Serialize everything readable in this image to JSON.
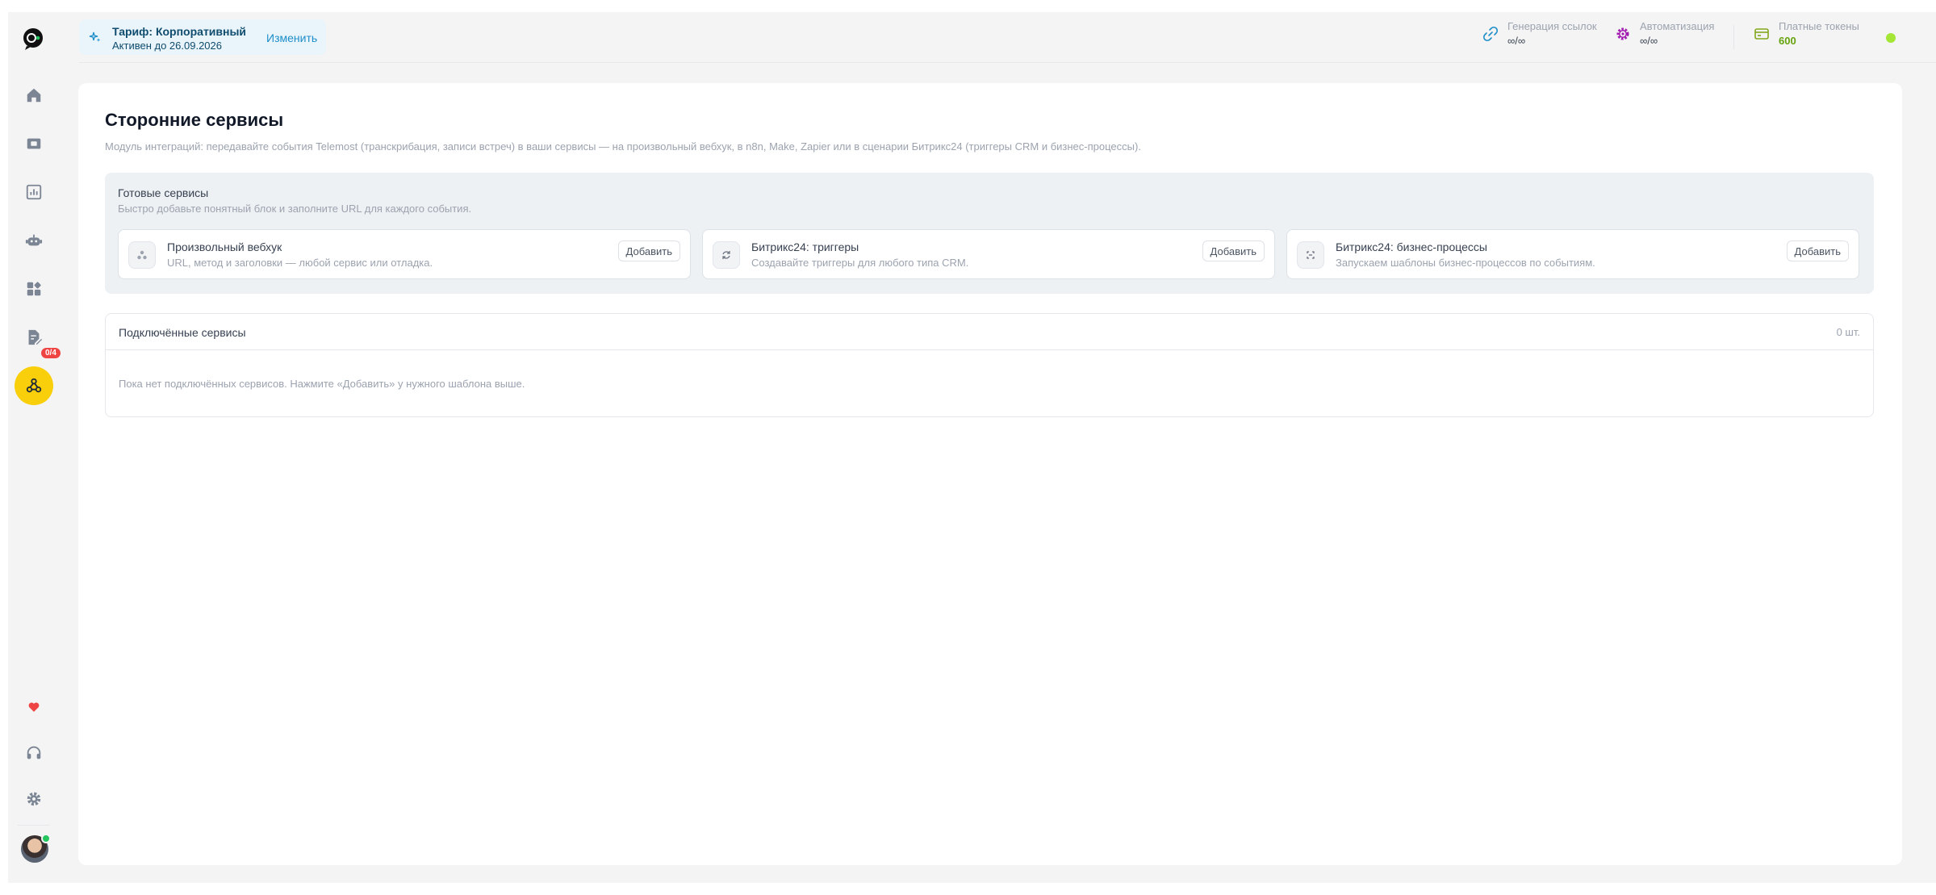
{
  "header": {
    "tariff_title": "Тариф: Корпоративный",
    "tariff_sub": "Активен до 26.09.2026",
    "tariff_change": "Изменить",
    "stats": [
      {
        "label": "Генерация ссылок",
        "value": "∞/∞",
        "icon": "link-icon"
      },
      {
        "label": "Автоматизация",
        "value": "∞/∞",
        "icon": "gear-icon"
      },
      {
        "label": "Платные токены",
        "value": "600",
        "icon": "wallet-icon"
      }
    ]
  },
  "sidebar": {
    "items": [
      {
        "icon": "home-icon"
      },
      {
        "icon": "video-icon"
      },
      {
        "icon": "chart-icon"
      },
      {
        "icon": "robot-icon"
      },
      {
        "icon": "apps-icon"
      },
      {
        "icon": "document-edit-icon",
        "badge": "0/4"
      },
      {
        "icon": "webhook-icon",
        "active": true
      }
    ],
    "bottom": [
      {
        "icon": "heart-icon"
      },
      {
        "icon": "headset-icon"
      },
      {
        "icon": "settings-icon"
      }
    ]
  },
  "main": {
    "title": "Сторонние сервисы",
    "description": "Модуль интеграций: передавайте события Telemost (транскрибация, записи встреч) в ваши сервисы — на произвольный вебхук, в n8n, Make, Zapier или в сценарии Битрикс24 (триггеры CRM и бизнес-процессы).",
    "ready": {
      "title": "Готовые сервисы",
      "subtitle": "Быстро добавьте понятный блок и заполните URL для каждого события.",
      "services": [
        {
          "name": "Произвольный вебхук",
          "desc": "URL, метод и заголовки — любой сервис или отладка.",
          "button": "Добавить",
          "icon": "webhook-icon"
        },
        {
          "name": "Битрикс24: триггеры",
          "desc": "Создавайте триггеры для любого типа CRM.",
          "button": "Добавить",
          "icon": "refresh-icon"
        },
        {
          "name": "Битрикс24: бизнес-процессы",
          "desc": "Запускаем шаблоны бизнес-процессов по событиям.",
          "button": "Добавить",
          "icon": "process-icon"
        }
      ]
    },
    "connected": {
      "title": "Подключённые сервисы",
      "count": "0 шт.",
      "empty": "Пока нет подключённых сервисов. Нажмите «Добавить» у нужного шаблона выше."
    }
  },
  "colors": {
    "accent": "#f9cf0b",
    "link": "#1d8ec9",
    "tokens": "#65a30d",
    "badge": "#ef4444"
  }
}
